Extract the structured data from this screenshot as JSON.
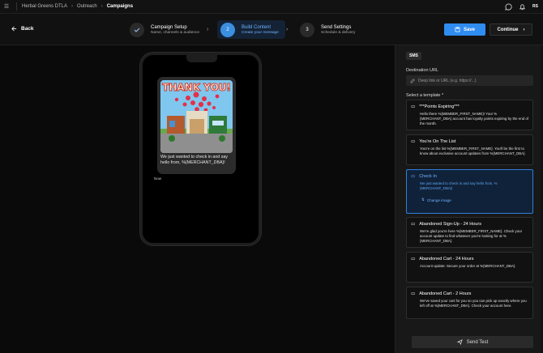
{
  "topbar": {
    "menu_icon": "hamburger-icon",
    "breadcrumbs": [
      "Herbal Greens DTLA",
      "Outreach",
      "Campaigns"
    ],
    "avatar": "RS"
  },
  "stepper": {
    "back_label": "Back",
    "steps": [
      {
        "number": "",
        "title": "Campaign Setup",
        "subtitle": "Name, channels & audience",
        "state": "done"
      },
      {
        "number": "2",
        "title": "Build Content",
        "subtitle": "Create your message",
        "state": "active"
      },
      {
        "number": "3",
        "title": "Send Settings",
        "subtitle": "Schedule & delivery",
        "state": "pending"
      }
    ],
    "save_label": "Save",
    "continue_label": "Continue"
  },
  "preview": {
    "image_caption": "THANK YOU!",
    "message": "We just wanted to check in and say hello from, %{MERCHANT_DBA}!",
    "timestamp": "Now"
  },
  "panel": {
    "channel_tag": "SMS",
    "destination_label": "Destination URL",
    "destination_placeholder": "Deep link or URL (e.g. https://...)",
    "template_label": "Select a template *",
    "templates": [
      {
        "title": "***Points Expiring***",
        "body": "Hello there %{MEMBER_FIRST_NAME}! Your %{MERCHANT_DBA} account has loyalty points expiring by the end of the month."
      },
      {
        "title": "You're On The List",
        "body": "You're on the list %{MEMBER_FIRST_NAME}. You'll be the first to know about exclusive account updates from %{MERCHANT_DBA}."
      },
      {
        "title": "Check In",
        "body": "We just wanted to check in and say hello from, %{MERCHANT_DBA}!",
        "selected": true,
        "action": "Change image"
      },
      {
        "title": "Abandoned Sign-Up - 24 Hours",
        "body": "We're glad you're here %{MEMBER_FIRST_NAME}. Check your account update to find whatever you're looking for at %{MERCHANT_DBA}."
      },
      {
        "title": "Abandoned Cart - 24 Hours",
        "body": "Account update: Secure your order at %{MERCHANT_DBA}."
      },
      {
        "title": "Abandoned Cart - 2 Hours",
        "body": "We've saved your cart for you so you can pick up exactly where you left off at %{MERCHANT_DBA}. Check your account here."
      }
    ],
    "send_test_label": "Send Test"
  },
  "colors": {
    "accent": "#2f8cf0",
    "accent_text": "#6fb4ff",
    "selected_bg": "#10223a"
  }
}
